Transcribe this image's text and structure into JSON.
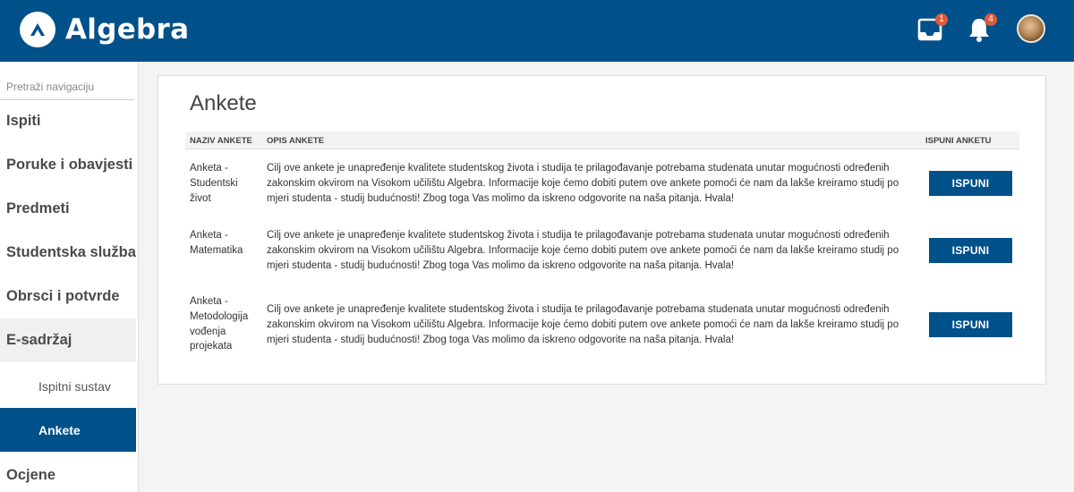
{
  "header": {
    "logo_text": "Algebra",
    "messages_badge": "1",
    "notifications_badge": "4",
    "brand_color": "#00508a",
    "badge_color": "#e05a3a"
  },
  "sidebar": {
    "search_placeholder": "Pretraži navigaciju",
    "items": [
      {
        "label": "Ispiti"
      },
      {
        "label": "Poruke i obavjesti"
      },
      {
        "label": "Predmeti"
      },
      {
        "label": "Studentska služba"
      },
      {
        "label": "Obrsci i potvrde"
      },
      {
        "label": "E-sadržaj"
      },
      {
        "label": "Ispitni sustav"
      },
      {
        "label": "Ankete"
      },
      {
        "label": "Ocjene"
      }
    ]
  },
  "main": {
    "title": "Ankete",
    "columns": [
      "NAZIV ANKETE",
      "OPIS ANKETE",
      "ISPUNI ANKETU"
    ],
    "rows": [
      {
        "name": "Anketa - Studentski život",
        "description": "Cilj ove ankete je unapređenje kvalitete studentskog života i studija te prilagođavanje potrebama studenata unutar mogućnosti određenih zakonskim okvirom na Visokom učilištu Algebra. Informacije koje ćemo dobiti putem ove ankete pomoći će nam da lakše kreiramo studij po mjeri studenta - studij budućnosti! Zbog toga Vas molimo da iskreno odgovorite na naša pitanja. Hvala!",
        "button": "ISPUNI"
      },
      {
        "name": "Anketa - Matematika",
        "description": "Cilj ove ankete je unapređenje kvalitete studentskog života i studija te prilagođavanje potrebama studenata unutar mogućnosti određenih zakonskim okvirom na Visokom učilištu Algebra. Informacije koje ćemo dobiti putem ove ankete pomoći će nam da lakše kreiramo studij po mjeri studenta - studij budućnosti! Zbog toga Vas molimo da iskreno odgovorite na naša pitanja. Hvala!",
        "button": "ISPUNI"
      },
      {
        "name": "Anketa - Metodologija vođenja projekata",
        "description": "Cilj ove ankete je unapređenje kvalitete studentskog života i studija te prilagođavanje potrebama studenata unutar mogućnosti određenih zakonskim okvirom na Visokom učilištu Algebra. Informacije koje ćemo dobiti putem ove ankete pomoći će nam da lakše kreiramo studij po mjeri studenta - studij budućnosti! Zbog toga Vas molimo da iskreno odgovorite na naša pitanja. Hvala!",
        "button": "ISPUNI"
      }
    ]
  }
}
